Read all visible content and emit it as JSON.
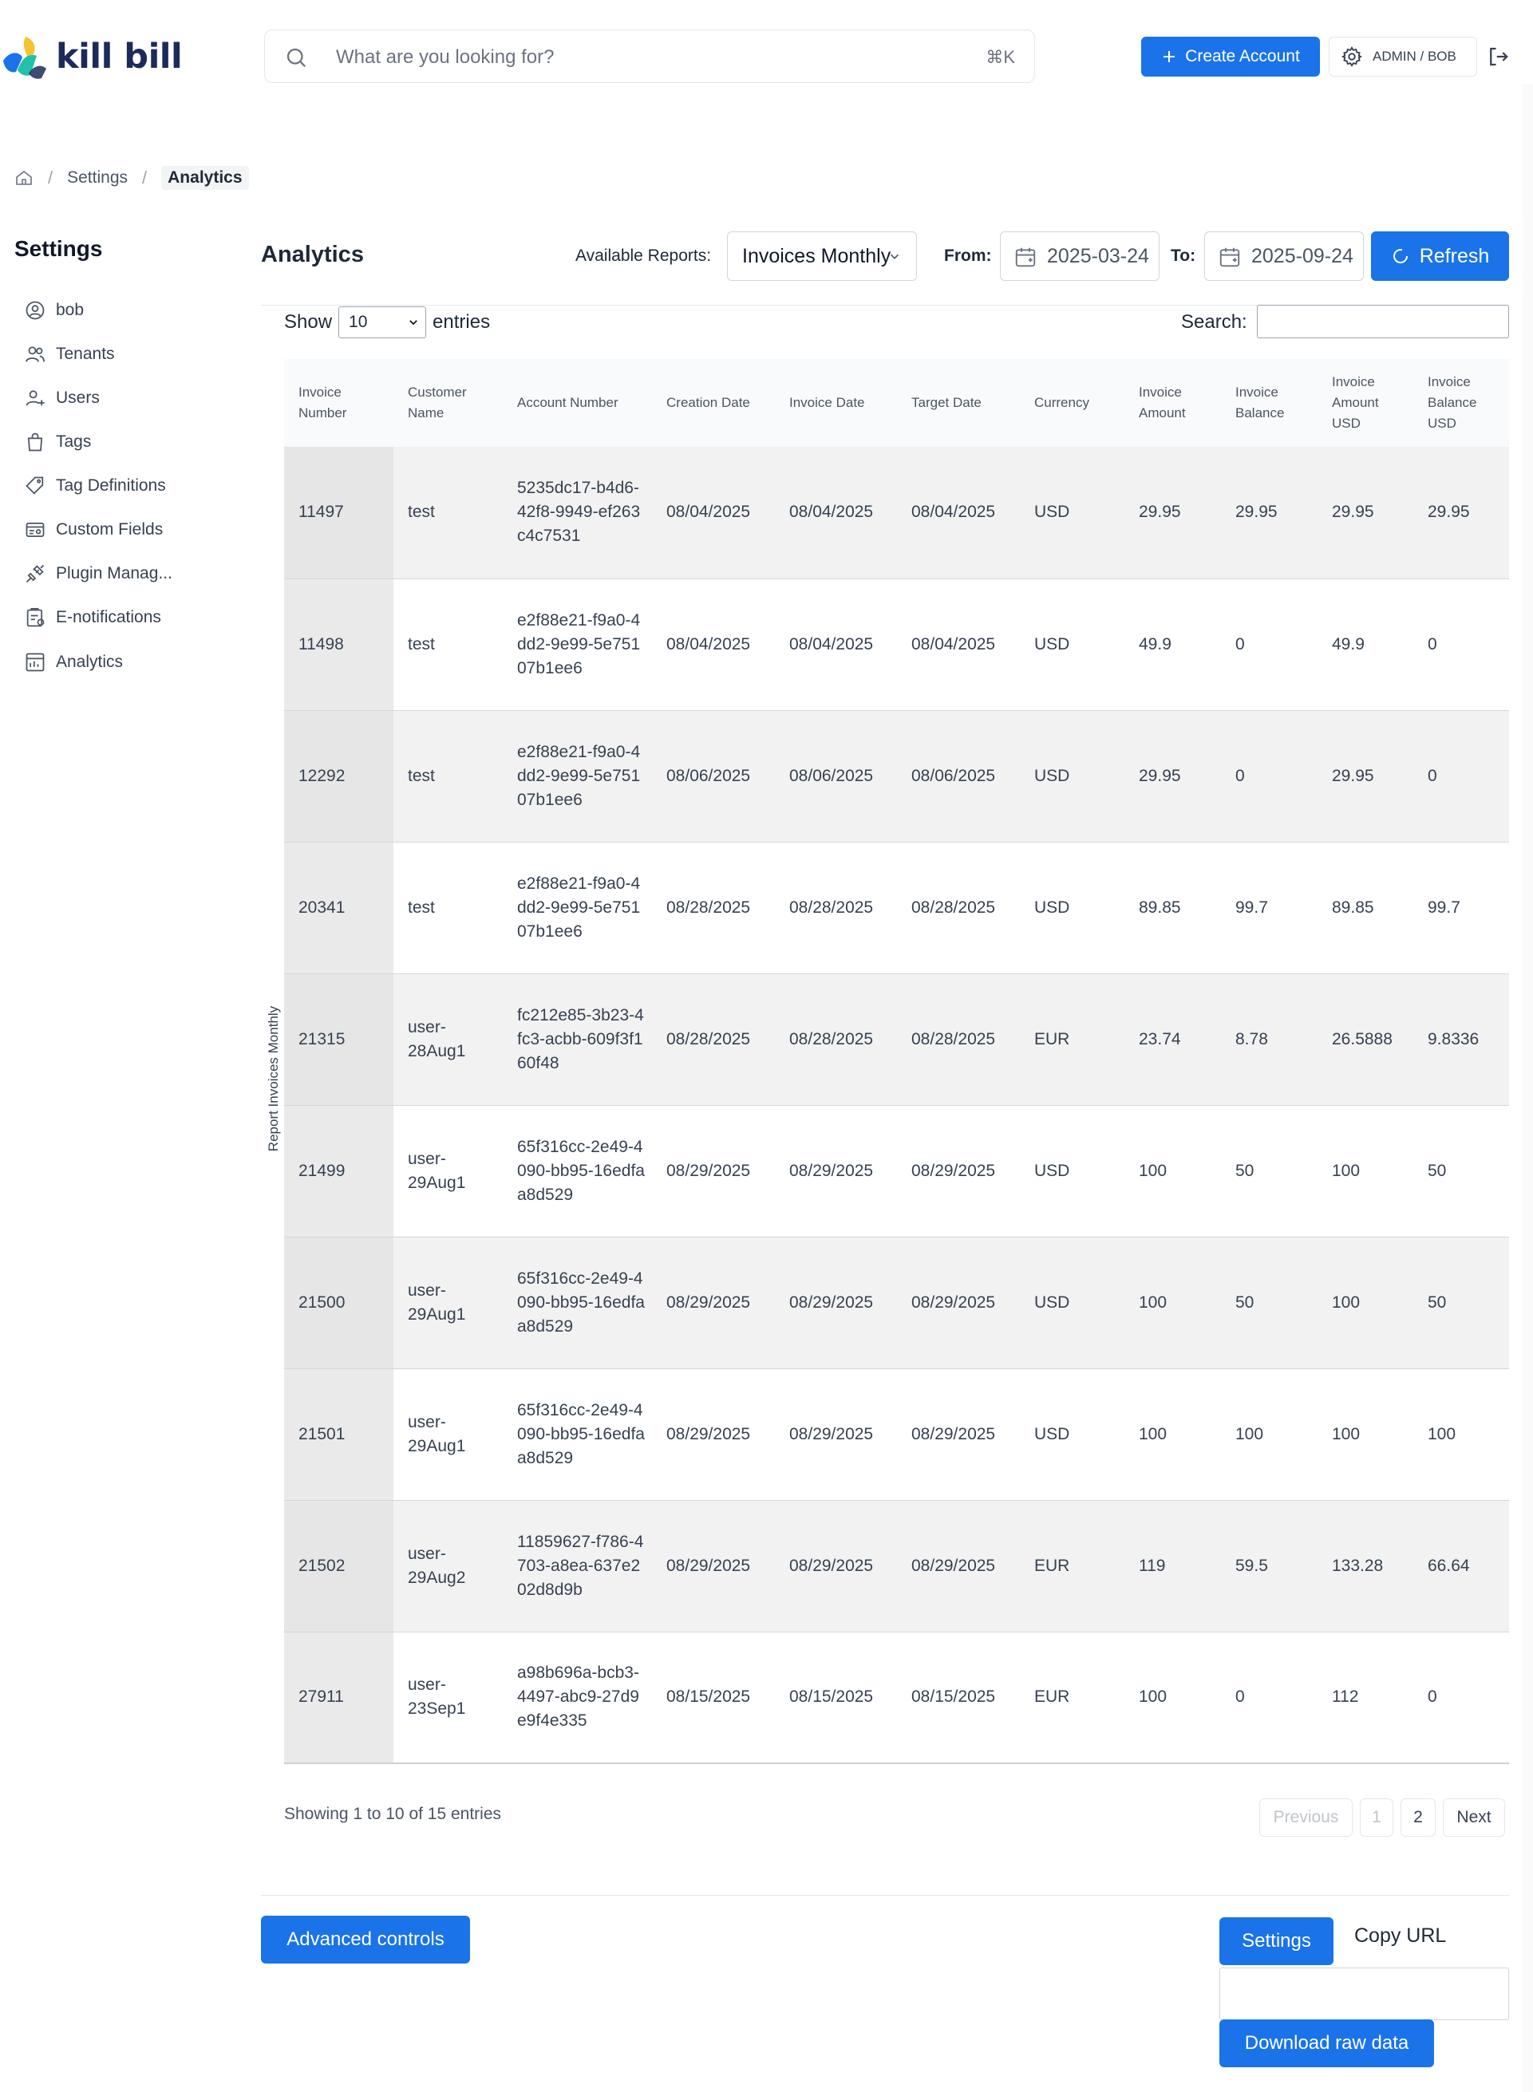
{
  "app": {
    "logo_text": "kill bill",
    "search_placeholder": "What are you looking for?",
    "search_shortcut": "⌘K",
    "create_account_label": "Create Account",
    "user_label": "ADMIN / BOB",
    "icons": {
      "search": "search-icon",
      "create": "plus-icon",
      "settings": "gear-icon",
      "logout": "logout-icon"
    },
    "accent_color": "#1a73e8"
  },
  "breadcrumb": {
    "items": [
      "Settings",
      "Analytics"
    ],
    "separator": "/"
  },
  "sidebar": {
    "title": "Settings",
    "items": [
      {
        "label": "bob",
        "icon": "user-circle-icon"
      },
      {
        "label": "Tenants",
        "icon": "users-icon"
      },
      {
        "label": "Users",
        "icon": "user-plus-icon"
      },
      {
        "label": "Tags",
        "icon": "shopping-bag-icon"
      },
      {
        "label": "Tag Definitions",
        "icon": "tag-icon"
      },
      {
        "label": "Custom Fields",
        "icon": "id-card-icon"
      },
      {
        "label": "Plugin Manag...",
        "icon": "plug-icon"
      },
      {
        "label": "E-notifications",
        "icon": "clipboard-icon"
      },
      {
        "label": "Analytics",
        "icon": "chart-icon"
      }
    ]
  },
  "main": {
    "title": "Analytics",
    "available_reports_label": "Available Reports:",
    "selected_report": "Invoices Monthly",
    "from_label": "From:",
    "from_value": "2025-03-24",
    "to_label": "To:",
    "to_value": "2025-09-24",
    "refresh_label": "Refresh"
  },
  "table_controls": {
    "show_label": "Show",
    "entries_value": "10",
    "entries_label": "entries",
    "search_label": "Search:",
    "search_value": ""
  },
  "report_label": "Report Invoices Monthly",
  "table": {
    "columns": [
      "Invoice Number",
      "Customer Name",
      "Account Number",
      "Creation Date",
      "Invoice Date",
      "Target Date",
      "Currency",
      "Invoice Amount",
      "Invoice Balance",
      "Invoice Amount USD",
      "Invoice Balance USD"
    ],
    "rows": [
      [
        "11497",
        "test",
        "5235dc17-b4d6-42f8-9949-ef263c4c7531",
        "08/04/2025",
        "08/04/2025",
        "08/04/2025",
        "USD",
        "29.95",
        "29.95",
        "29.95",
        "29.95"
      ],
      [
        "11498",
        "test",
        "e2f88e21-f9a0-4dd2-9e99-5e75107b1ee6",
        "08/04/2025",
        "08/04/2025",
        "08/04/2025",
        "USD",
        "49.9",
        "0",
        "49.9",
        "0"
      ],
      [
        "12292",
        "test",
        "e2f88e21-f9a0-4dd2-9e99-5e75107b1ee6",
        "08/06/2025",
        "08/06/2025",
        "08/06/2025",
        "USD",
        "29.95",
        "0",
        "29.95",
        "0"
      ],
      [
        "20341",
        "test",
        "e2f88e21-f9a0-4dd2-9e99-5e75107b1ee6",
        "08/28/2025",
        "08/28/2025",
        "08/28/2025",
        "USD",
        "89.85",
        "99.7",
        "89.85",
        "99.7"
      ],
      [
        "21315",
        "user-28Aug1",
        "fc212e85-3b23-4fc3-acbb-609f3f160f48",
        "08/28/2025",
        "08/28/2025",
        "08/28/2025",
        "EUR",
        "23.74",
        "8.78",
        "26.5888",
        "9.8336"
      ],
      [
        "21499",
        "user-29Aug1",
        "65f316cc-2e49-4090-bb95-16edfaa8d529",
        "08/29/2025",
        "08/29/2025",
        "08/29/2025",
        "USD",
        "100",
        "50",
        "100",
        "50"
      ],
      [
        "21500",
        "user-29Aug1",
        "65f316cc-2e49-4090-bb95-16edfaa8d529",
        "08/29/2025",
        "08/29/2025",
        "08/29/2025",
        "USD",
        "100",
        "50",
        "100",
        "50"
      ],
      [
        "21501",
        "user-29Aug1",
        "65f316cc-2e49-4090-bb95-16edfaa8d529",
        "08/29/2025",
        "08/29/2025",
        "08/29/2025",
        "USD",
        "100",
        "100",
        "100",
        "100"
      ],
      [
        "21502",
        "user-29Aug2",
        "11859627-f786-4703-a8ea-637e202d8d9b",
        "08/29/2025",
        "08/29/2025",
        "08/29/2025",
        "EUR",
        "119",
        "59.5",
        "133.28",
        "66.64"
      ],
      [
        "27911",
        "user-23Sep1",
        "a98b696a-bcb3-4497-abc9-27d9e9f4e335",
        "08/15/2025",
        "08/15/2025",
        "08/15/2025",
        "EUR",
        "100",
        "0",
        "112",
        "0"
      ]
    ]
  },
  "pagination": {
    "summary": "Showing 1 to 10 of 15 entries",
    "previous": "Previous",
    "pages": [
      "1",
      "2"
    ],
    "next": "Next"
  },
  "footer": {
    "advanced_controls": "Advanced controls",
    "settings": "Settings",
    "copy_url": "Copy URL",
    "url_value": "",
    "download_raw": "Download raw data"
  }
}
